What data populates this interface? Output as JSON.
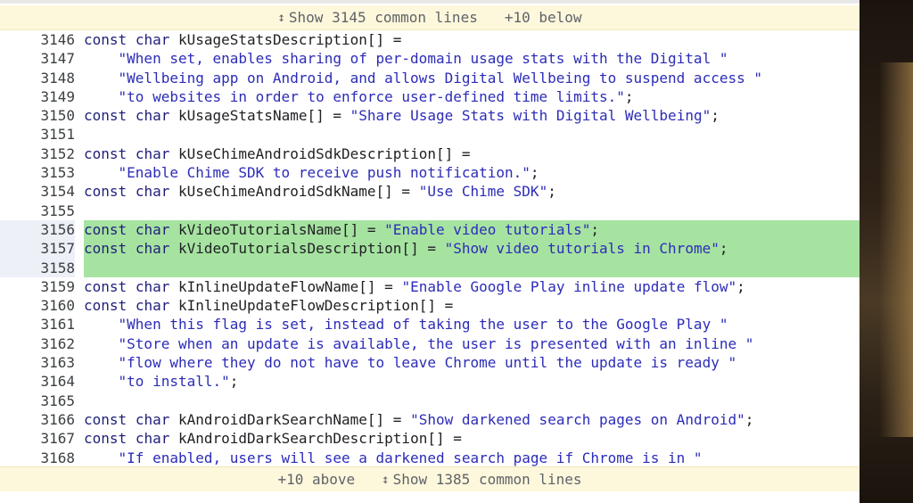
{
  "top_bar": {
    "show_label": "Show 3145 common lines",
    "below_label": "+10 below"
  },
  "bottom_bar": {
    "above_label": "+10 above",
    "show_label": "Show 1385 common lines"
  },
  "lines": [
    {
      "n": "3146",
      "t": "const char kUsageStatsDescription[] =",
      "added": false
    },
    {
      "n": "3147",
      "t": "    \"When set, enables sharing of per-domain usage stats with the Digital \"",
      "added": false
    },
    {
      "n": "3148",
      "t": "    \"Wellbeing app on Android, and allows Digital Wellbeing to suspend access \"",
      "added": false
    },
    {
      "n": "3149",
      "t": "    \"to websites in order to enforce user-defined time limits.\";",
      "added": false
    },
    {
      "n": "3150",
      "t": "const char kUsageStatsName[] = \"Share Usage Stats with Digital Wellbeing\";",
      "added": false
    },
    {
      "n": "3151",
      "t": "",
      "added": false
    },
    {
      "n": "3152",
      "t": "const char kUseChimeAndroidSdkDescription[] =",
      "added": false
    },
    {
      "n": "3153",
      "t": "    \"Enable Chime SDK to receive push notification.\";",
      "added": false
    },
    {
      "n": "3154",
      "t": "const char kUseChimeAndroidSdkName[] = \"Use Chime SDK\";",
      "added": false
    },
    {
      "n": "3155",
      "t": "",
      "added": false
    },
    {
      "n": "3156",
      "t": "const char kVideoTutorialsName[] = \"Enable video tutorials\";",
      "added": true
    },
    {
      "n": "3157",
      "t": "const char kVideoTutorialsDescription[] = \"Show video tutorials in Chrome\";",
      "added": true
    },
    {
      "n": "3158",
      "t": "",
      "added": true
    },
    {
      "n": "3159",
      "t": "const char kInlineUpdateFlowName[] = \"Enable Google Play inline update flow\";",
      "added": false
    },
    {
      "n": "3160",
      "t": "const char kInlineUpdateFlowDescription[] =",
      "added": false
    },
    {
      "n": "3161",
      "t": "    \"When this flag is set, instead of taking the user to the Google Play \"",
      "added": false
    },
    {
      "n": "3162",
      "t": "    \"Store when an update is available, the user is presented with an inline \"",
      "added": false
    },
    {
      "n": "3163",
      "t": "    \"flow where they do not have to leave Chrome until the update is ready \"",
      "added": false
    },
    {
      "n": "3164",
      "t": "    \"to install.\";",
      "added": false
    },
    {
      "n": "3165",
      "t": "",
      "added": false
    },
    {
      "n": "3166",
      "t": "const char kAndroidDarkSearchName[] = \"Show darkened search pages on Android\";",
      "added": false
    },
    {
      "n": "3167",
      "t": "const char kAndroidDarkSearchDescription[] =",
      "added": false
    },
    {
      "n": "3168",
      "t": "    \"If enabled, users will see a darkened search page if Chrome is in \"",
      "added": false
    }
  ],
  "colors": {
    "added_bg": "#a6e3a1",
    "string": "#2c2cb8",
    "keyword": "#1f1f7a",
    "expand_bg": "#fdf7dc"
  },
  "icons": {
    "expand": "unfold-icon"
  }
}
